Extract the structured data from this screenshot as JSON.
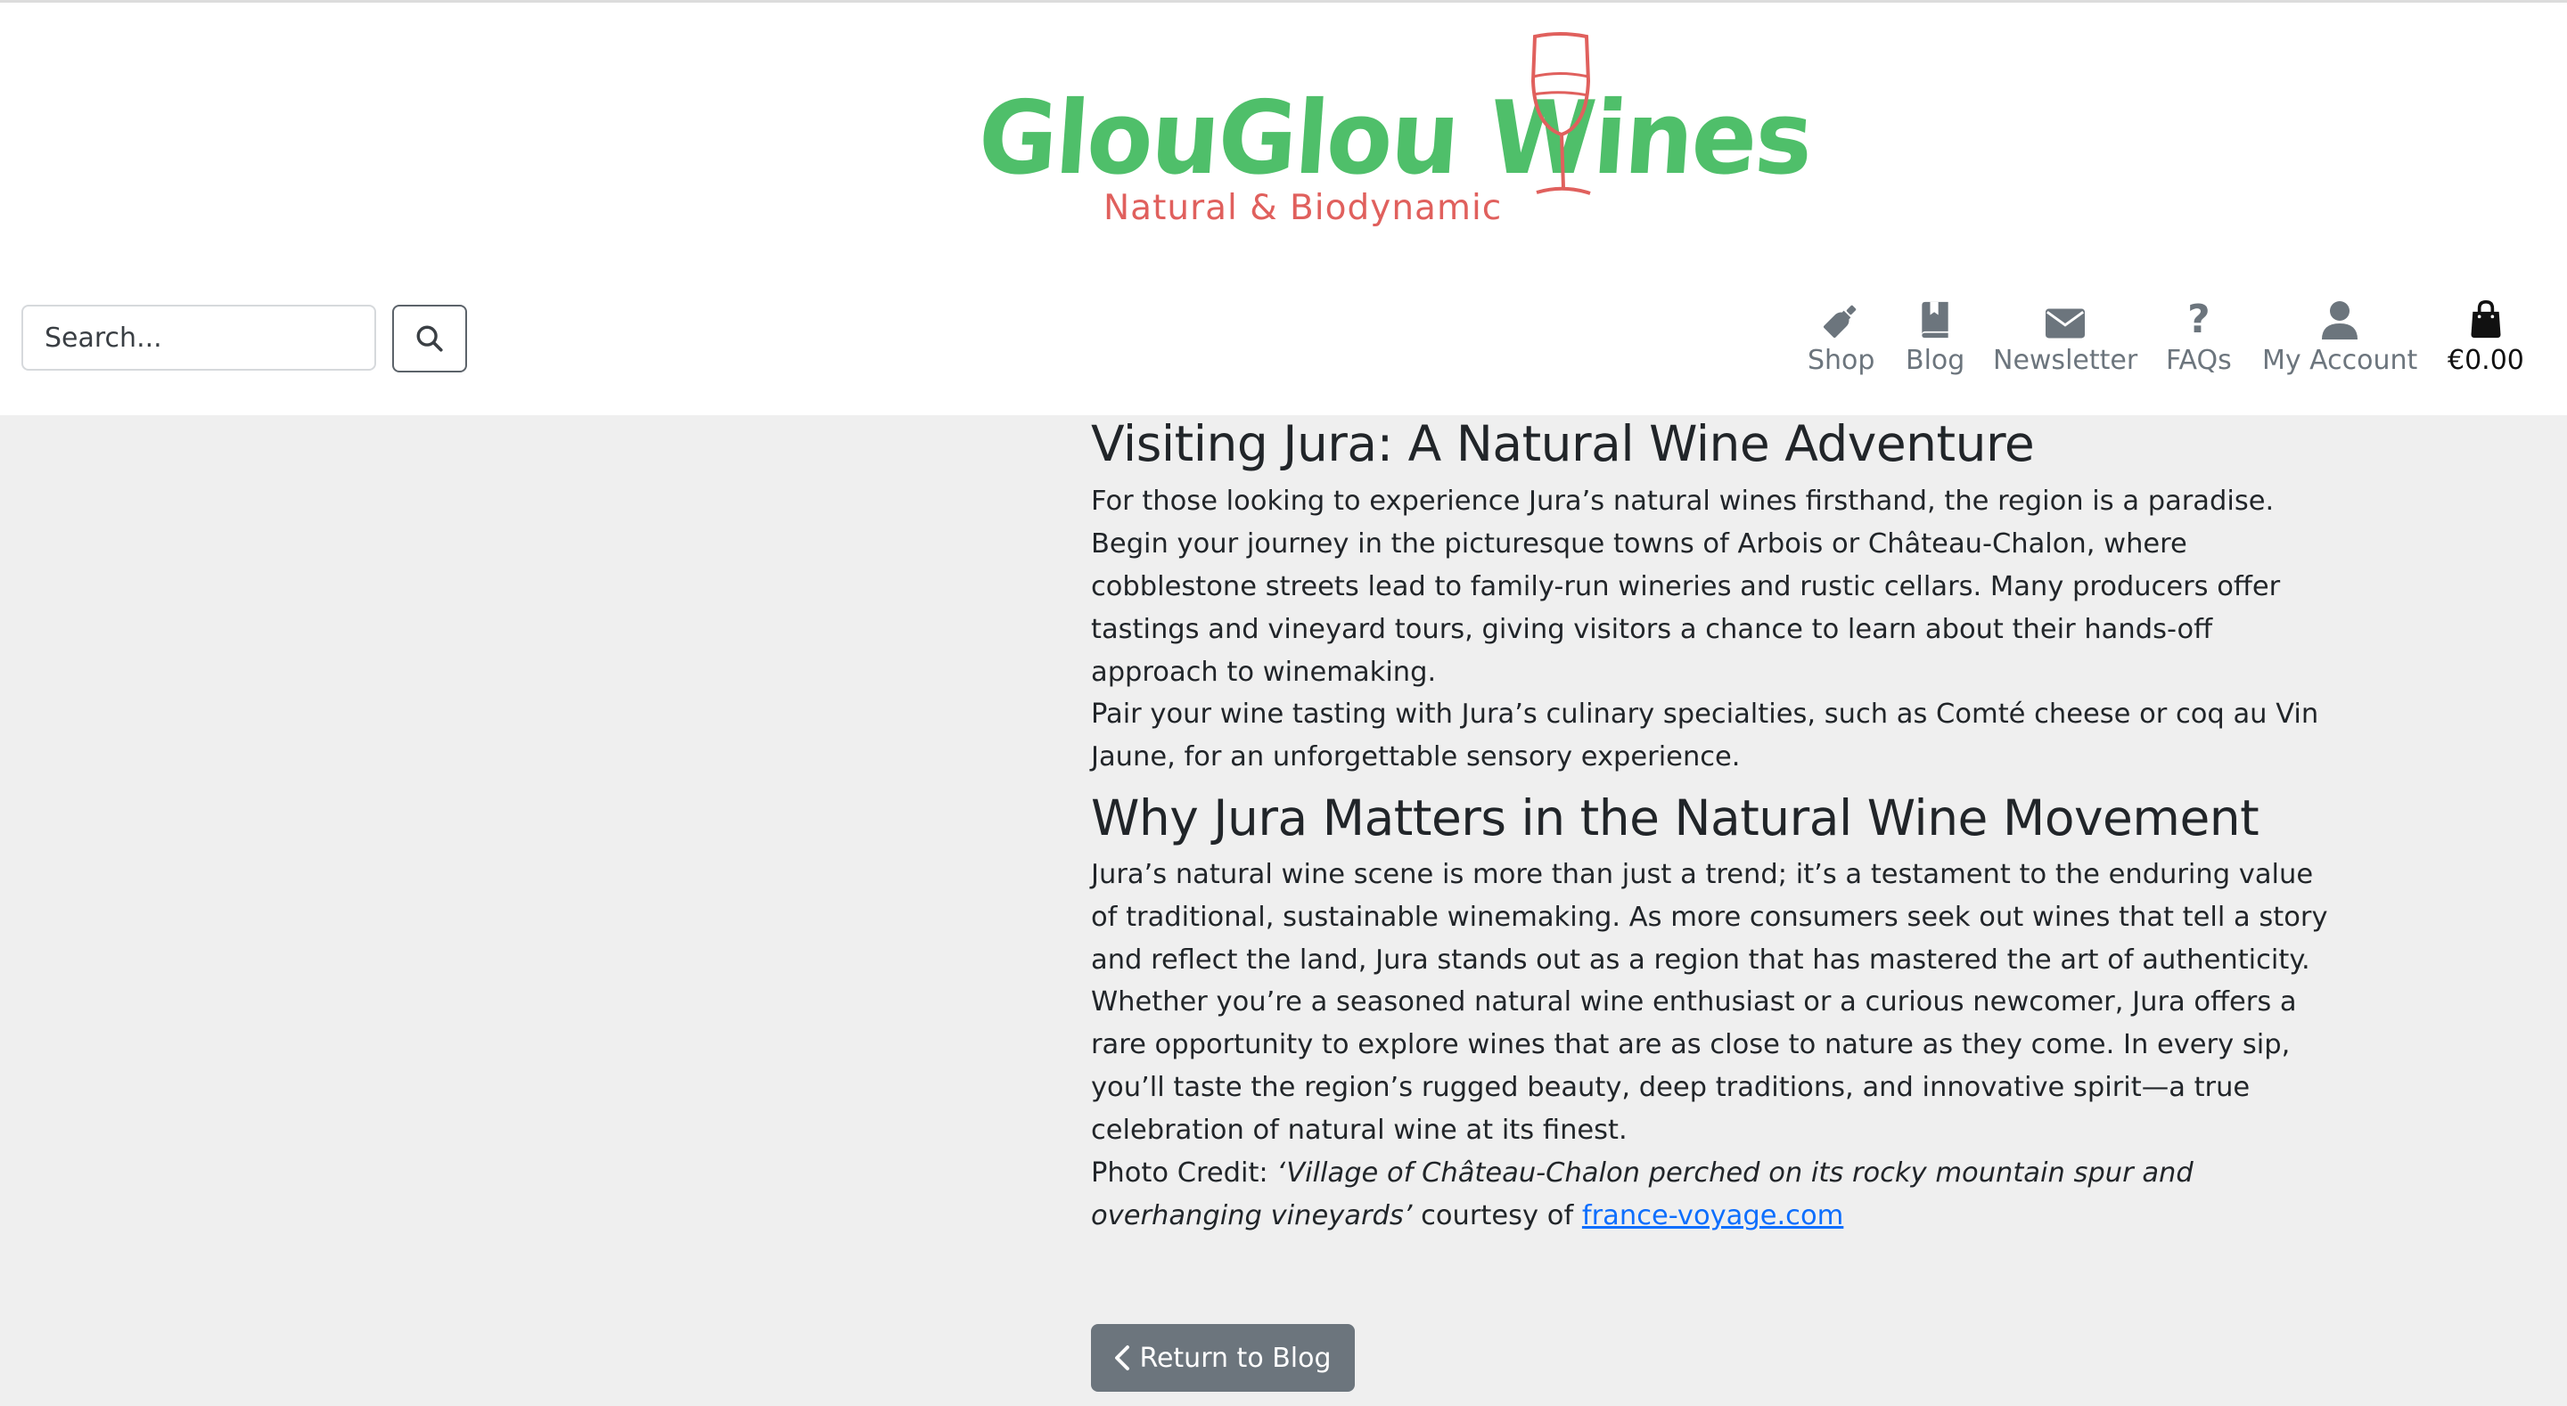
{
  "brand": {
    "name": "GlouGlou Wines",
    "tagline": "Natural & Biodynamic",
    "green": "#4fbf6a",
    "red": "#e0605d",
    "logo_icon": "wine-glass-icon"
  },
  "search": {
    "placeholder": "Search...",
    "button_icon": "search-icon"
  },
  "nav": {
    "items": [
      {
        "label": "Shop",
        "icon": "wine-bottle-icon"
      },
      {
        "label": "Blog",
        "icon": "book-icon"
      },
      {
        "label": "Newsletter",
        "icon": "envelope-icon"
      },
      {
        "label": "FAQs",
        "icon": "question-icon"
      },
      {
        "label": "My Account",
        "icon": "user-icon"
      }
    ],
    "cart": {
      "label": "€0.00",
      "icon": "shopping-bag-icon"
    }
  },
  "article": {
    "section1_heading": "Visiting Jura: A Natural Wine Adventure",
    "section1_para1": "For those looking to experience Jura’s natural wines firsthand, the region is a paradise. Begin your journey in the picturesque towns of Arbois or Château-Chalon, where cobblestone streets lead to family-run wineries and rustic cellars. Many producers offer tastings and vineyard tours, giving visitors a chance to learn about their hands-off approach to winemaking.",
    "section1_para2": "Pair your wine tasting with Jura’s culinary specialties, such as Comté cheese or coq au Vin Jaune, for an unforgettable sensory experience.",
    "section2_heading": "Why Jura Matters in the Natural Wine Movement",
    "section2_para1": "Jura’s natural wine scene is more than just a trend; it’s a testament to the enduring value of traditional, sustainable winemaking. As more consumers seek out wines that tell a story and reflect the land, Jura stands out as a region that has mastered the art of authenticity.",
    "section2_para2": "Whether you’re a seasoned natural wine enthusiast or a curious newcomer, Jura offers a rare opportunity to explore wines that are as close to nature as they come. In every sip, you’ll taste the region’s rugged beauty, deep traditions, and innovative spirit—a true celebration of natural wine at its finest.",
    "credit_prefix": "Photo Credit: ",
    "credit_caption": "‘Village of Château-Chalon perched on its rocky mountain spur and overhanging vineyards’",
    "credit_middle": " courtesy of ",
    "credit_link": "france-voyage.com"
  },
  "return_button": {
    "label": "Return to Blog",
    "icon": "chevron-left-icon"
  }
}
